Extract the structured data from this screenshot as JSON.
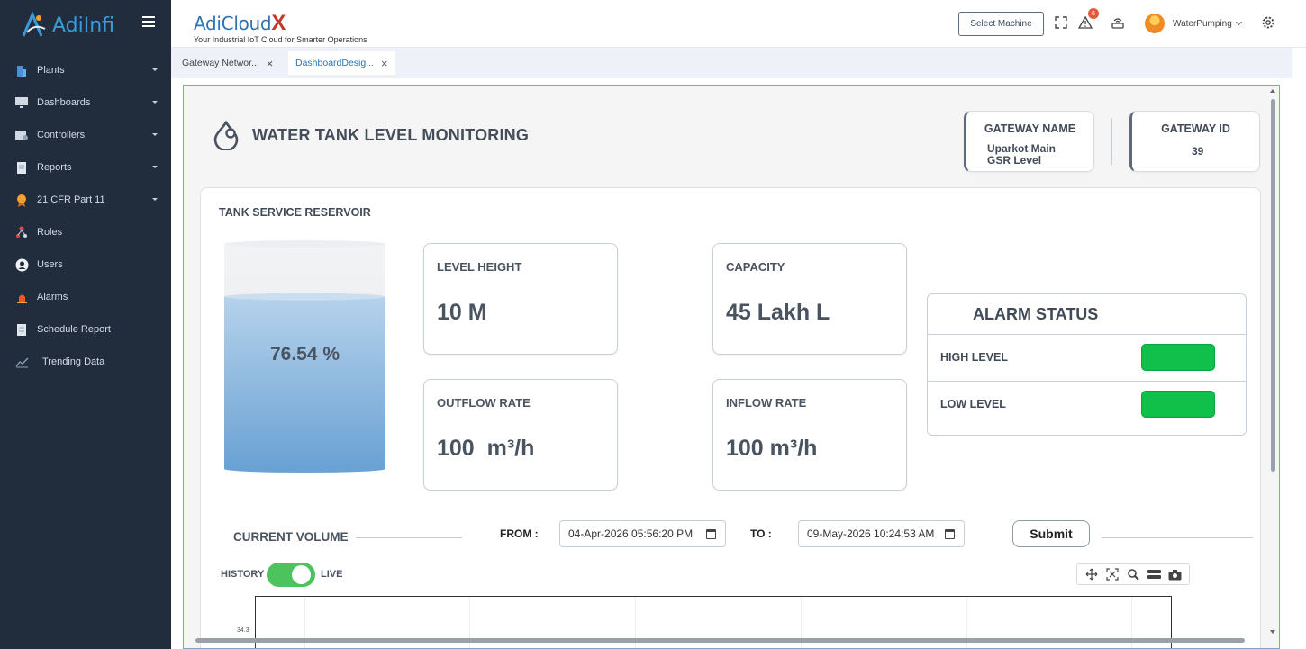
{
  "sidebar": {
    "logo_text": "AdiInfi",
    "items": [
      {
        "label": "Plants",
        "icon": "building-icon",
        "has_caret": true
      },
      {
        "label": "Dashboards",
        "icon": "monitor-icon",
        "has_caret": true
      },
      {
        "label": "Controllers",
        "icon": "controller-icon",
        "has_caret": true
      },
      {
        "label": "Reports",
        "icon": "report-icon",
        "has_caret": true
      },
      {
        "label": "21 CFR Part 11",
        "icon": "award-icon",
        "has_caret": true
      },
      {
        "label": "Roles",
        "icon": "roles-icon",
        "has_caret": false
      },
      {
        "label": "Users",
        "icon": "user-icon",
        "has_caret": false
      },
      {
        "label": "Alarms",
        "icon": "siren-icon",
        "has_caret": false
      },
      {
        "label": "Schedule Report",
        "icon": "schedule-icon",
        "has_caret": false
      },
      {
        "label": "Trending Data",
        "icon": "trend-icon",
        "has_caret": false
      }
    ]
  },
  "topbar": {
    "brand_name": "AdiCloud",
    "brand_suffix": "X",
    "brand_tagline": "Your Industrial IoT Cloud for Smarter Operations",
    "select_machine_label": "Select Machine",
    "alert_count": "6",
    "user_name": "WaterPumping"
  },
  "tabs": [
    {
      "label": "Gateway Networ...",
      "active": false
    },
    {
      "label": "DashboardDesig...",
      "active": true
    }
  ],
  "dashboard": {
    "title": "WATER TANK LEVEL MONITORING",
    "gateway_name_label": "GATEWAY NAME",
    "gateway_name_value_1": "Uparkot Main",
    "gateway_name_value_2": "GSR Level",
    "gateway_id_label": "GATEWAY ID",
    "gateway_id_value": "39",
    "panel_title": "TANK SERVICE RESERVOIR",
    "tank_percent_text": "76.54 %",
    "tank_level_fraction": 0.7654,
    "metrics": {
      "level_height_label": "LEVEL HEIGHT",
      "level_height_value": "10 M",
      "capacity_label": "CAPACITY",
      "capacity_value": "45 Lakh L",
      "outflow_label": "OUTFLOW RATE",
      "outflow_value": "100  m³/h",
      "inflow_label": "INFLOW RATE",
      "inflow_value": "100 m³/h"
    },
    "alarm": {
      "title": "ALARM STATUS",
      "high_label": "HIGH LEVEL",
      "low_label": "LOW LEVEL",
      "status_color": "#11c04a"
    },
    "volume": {
      "label": "CURRENT VOLUME",
      "from_label": "FROM :",
      "from_value": "04-Apr-2026 05:56:20 PM",
      "to_label": "TO :",
      "to_value": "09-May-2026 10:24:53 AM",
      "submit_label": "Submit",
      "history_label": "HISTORY",
      "live_label": "LIVE",
      "toggle_on": true,
      "y_tick": "34.3"
    }
  },
  "colors": {
    "sidebar_bg": "#212c3d",
    "accent": "#2f73b3",
    "status_green": "#11c04a",
    "water": "#7aaedb"
  }
}
